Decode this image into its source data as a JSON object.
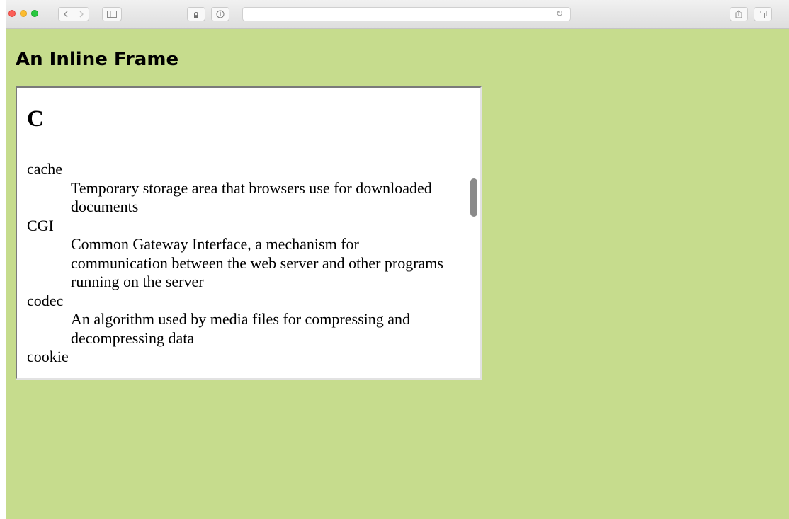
{
  "browser": {
    "nav_back_icon": "chevron-left-icon",
    "nav_forward_icon": "chevron-right-icon",
    "sidebar_icon": "sidebar-icon",
    "extension_icon": "extension-icon",
    "info_icon": "info-icon",
    "reload_icon": "reload-icon",
    "share_icon": "share-icon",
    "tabs_icon": "tabs-icon",
    "address": ""
  },
  "page": {
    "title": "An Inline Frame",
    "background_color": "#c6dc8d"
  },
  "iframe": {
    "heading": "C",
    "entries": [
      {
        "term": "cache",
        "definition": "Temporary storage area that browsers use for downloaded documents"
      },
      {
        "term": "CGI",
        "definition": "Common Gateway Interface, a mechanism for communication between the web server and other programs running on the server"
      },
      {
        "term": "codec",
        "definition": "An algorithm used by media files for compressing and decompressing data"
      },
      {
        "term": "cookie",
        "definition": ""
      }
    ]
  }
}
